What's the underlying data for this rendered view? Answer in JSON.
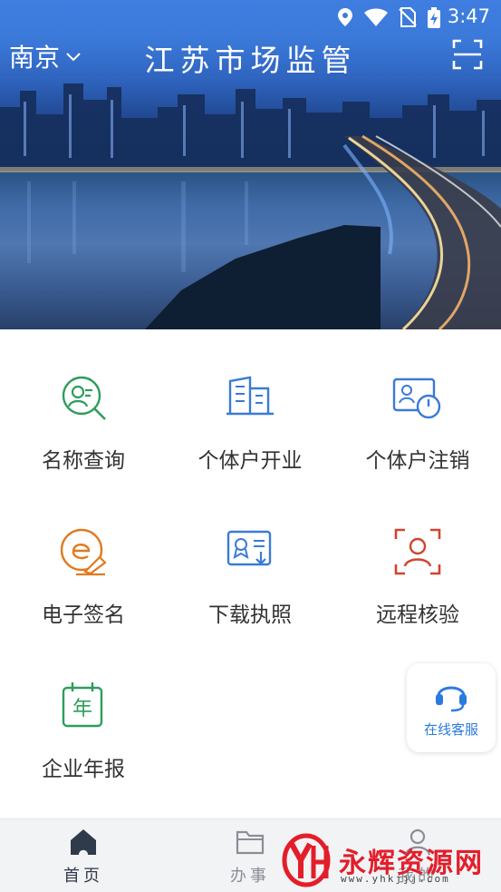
{
  "status_bar": {
    "time": "3:47"
  },
  "header": {
    "city": "南京",
    "title": "江苏市场监管"
  },
  "services": [
    {
      "label": "名称查询",
      "icon": "name-search-icon"
    },
    {
      "label": "个体户开业",
      "icon": "building-icon"
    },
    {
      "label": "个体户注销",
      "icon": "card-power-icon"
    },
    {
      "label": "电子签名",
      "icon": "e-signature-icon"
    },
    {
      "label": "下载执照",
      "icon": "license-download-icon"
    },
    {
      "label": "远程核验",
      "icon": "face-verify-icon"
    },
    {
      "label": "企业年报",
      "icon": "calendar-year-icon"
    }
  ],
  "calendar_icon_char": "年",
  "customer_service": {
    "label": "在线客服",
    "icon": "headset-icon"
  },
  "bottom_nav": [
    {
      "label": "首页",
      "icon": "home-icon",
      "active": true
    },
    {
      "label": "办事",
      "icon": "folder-icon",
      "active": false
    },
    {
      "label": "我的",
      "icon": "person-icon",
      "active": false
    }
  ],
  "watermark": {
    "brand": "永辉资源网",
    "url": "www.yhkjjj.com"
  },
  "colors": {
    "header_blue": "#3f7ee0",
    "green": "#2e9d5b",
    "blue": "#3a7bd5",
    "orange": "#e07a1f",
    "red": "#d0452e",
    "service_blue": "#2a7be0",
    "watermark_red": "#e31e2a"
  }
}
